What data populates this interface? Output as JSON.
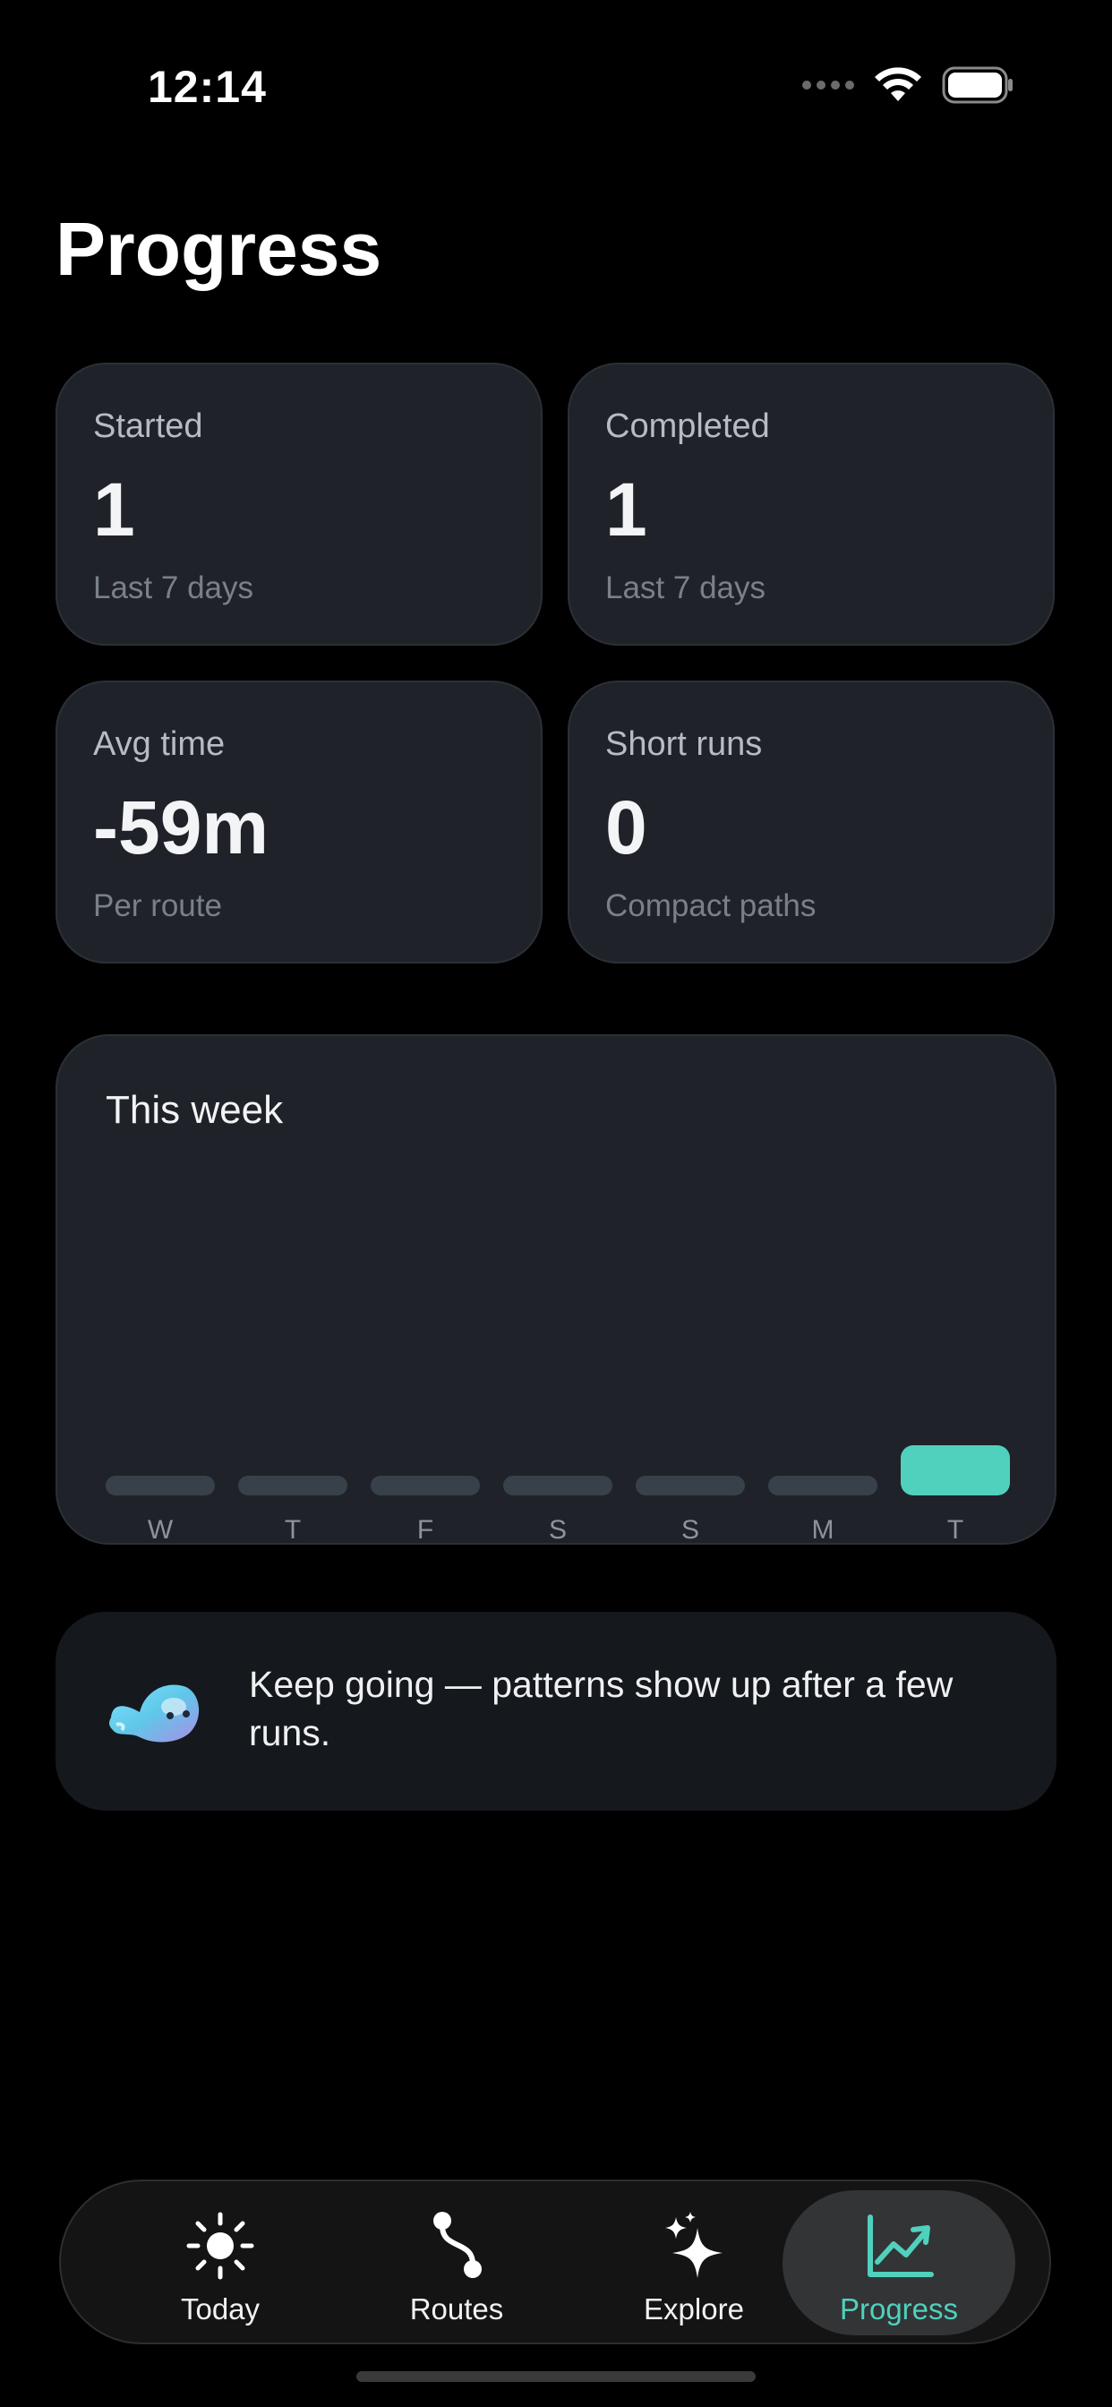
{
  "status_bar": {
    "time": "12:14"
  },
  "page": {
    "title": "Progress"
  },
  "stats": [
    {
      "label": "Started",
      "value": "1",
      "sub": "Last 7 days"
    },
    {
      "label": "Completed",
      "value": "1",
      "sub": "Last 7 days"
    },
    {
      "label": "Avg time",
      "value": "-59m",
      "sub": "Per route"
    },
    {
      "label": "Short runs",
      "value": "0",
      "sub": "Compact paths"
    }
  ],
  "week": {
    "title": "This week",
    "days": [
      "W",
      "T",
      "F",
      "S",
      "S",
      "M",
      "T"
    ],
    "values": [
      0,
      0,
      0,
      0,
      0,
      0,
      1
    ],
    "active_color": "#4fd1bd",
    "inactive_color": "#38414a"
  },
  "tip": {
    "text": "Keep going — patterns show up after a few runs."
  },
  "tabs": [
    {
      "label": "Today",
      "icon": "sun-icon"
    },
    {
      "label": "Routes",
      "icon": "route-icon"
    },
    {
      "label": "Explore",
      "icon": "sparkles-icon"
    },
    {
      "label": "Progress",
      "icon": "chart-line-icon",
      "active": true
    }
  ],
  "colors": {
    "accent": "#4fd1bd",
    "card": "#1f2329",
    "background": "#000000"
  }
}
